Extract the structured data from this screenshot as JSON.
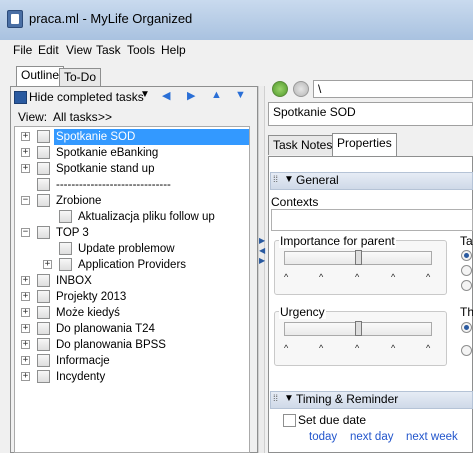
{
  "window": {
    "title": "praca.ml - MyLife Organized"
  },
  "menu": [
    "File",
    "Edit",
    "View",
    "Task",
    "Tools",
    "Help"
  ],
  "left_tabs": [
    {
      "label": "Outline",
      "active": true
    },
    {
      "label": "To-Do",
      "active": false
    }
  ],
  "toolbar": {
    "hide_completed_label": "Hide completed tasks"
  },
  "view": {
    "label": "View:",
    "value": "All tasks",
    "more": ">>"
  },
  "tree": [
    {
      "label": "Spotkanie SOD",
      "level": 0,
      "expander": true,
      "selected": true
    },
    {
      "label": "Spotkanie eBanking",
      "level": 0,
      "expander": true
    },
    {
      "label": "Spotkanie stand up",
      "level": 0,
      "expander": true
    },
    {
      "label": "------------------------------",
      "level": 0,
      "expander": false
    },
    {
      "label": "Zrobione",
      "level": 0,
      "expander": "minus"
    },
    {
      "label": "Aktualizacja pliku follow up",
      "level": 1,
      "expander": false
    },
    {
      "label": "TOP 3",
      "level": 0,
      "expander": "minus"
    },
    {
      "label": "Update problemow",
      "level": 1,
      "expander": false
    },
    {
      "label": "Application Providers",
      "level": 1,
      "expander": true
    },
    {
      "label": "INBOX",
      "level": 0,
      "expander": true
    },
    {
      "label": "Projekty 2013",
      "level": 0,
      "expander": true
    },
    {
      "label": "Może kiedyś",
      "level": 0,
      "expander": true
    },
    {
      "label": "Do planowania T24",
      "level": 0,
      "expander": true
    },
    {
      "label": "Do planowania BPSS",
      "level": 0,
      "expander": true
    },
    {
      "label": "Informacje",
      "level": 0,
      "expander": true
    },
    {
      "label": "Incydenty",
      "level": 0,
      "expander": true
    }
  ],
  "address": {
    "value": "\\"
  },
  "task": {
    "title": "Spotkanie SOD"
  },
  "right_tabs": [
    {
      "label": "Task Notes",
      "active": false
    },
    {
      "label": "Properties",
      "active": true
    }
  ],
  "properties": {
    "general_header": "General",
    "contexts_label": "Contexts",
    "importance_label": "Importance for parent",
    "urgency_label": "Urgency",
    "importance_level": 0.5,
    "urgency_level": 0.5,
    "right_clip_1": "Ta",
    "right_clip_2": "Th",
    "timing_header": "Timing & Reminder",
    "set_due_label": "Set due date",
    "links": [
      "today",
      "next day",
      "next week"
    ]
  },
  "colors": {
    "selection": "#3399ff",
    "link": "#2255cc",
    "accent": "#2a5aa0"
  }
}
